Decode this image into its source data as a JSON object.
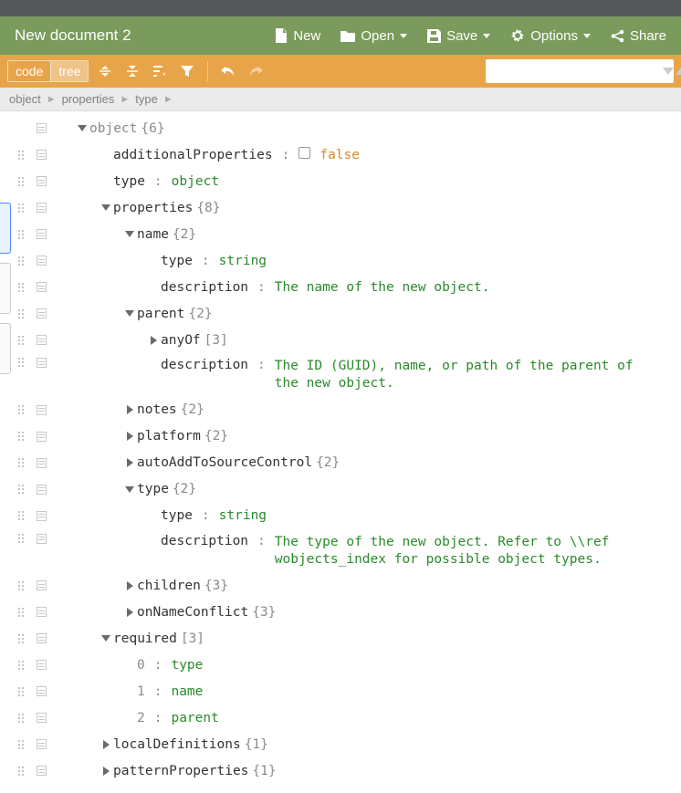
{
  "header": {
    "title": "New document 2",
    "menu": {
      "new": "New",
      "open": "Open",
      "save": "Save",
      "options": "Options",
      "share": "Share"
    }
  },
  "toolbar": {
    "mode_code": "code",
    "mode_tree": "tree",
    "search_placeholder": ""
  },
  "breadcrumb": {
    "parts": [
      "object",
      "properties",
      "type"
    ]
  },
  "tree": {
    "root": {
      "key": "object",
      "count": "{6}"
    },
    "addl": {
      "key": "additionalProperties",
      "value": "false"
    },
    "type_root": {
      "key": "type",
      "value": "object"
    },
    "props": {
      "key": "properties",
      "count": "{8}"
    },
    "name": {
      "key": "name",
      "count": "{2}"
    },
    "name_type": {
      "key": "type",
      "value": "string"
    },
    "name_desc": {
      "key": "description",
      "value": "The name of the new object."
    },
    "parent": {
      "key": "parent",
      "count": "{2}"
    },
    "parent_anyof": {
      "key": "anyOf",
      "count": "[3]"
    },
    "parent_desc": {
      "key": "description",
      "value": "The ID (GUID), name, or path of the parent of the new object."
    },
    "notes": {
      "key": "notes",
      "count": "{2}"
    },
    "platform": {
      "key": "platform",
      "count": "{2}"
    },
    "autoadd": {
      "key": "autoAddToSourceControl",
      "count": "{2}"
    },
    "type2": {
      "key": "type",
      "count": "{2}"
    },
    "type2_type": {
      "key": "type",
      "value": "string"
    },
    "type2_desc": {
      "key": "description",
      "value": "The type of the new object. Refer to \\\\ref wobjects_index for possible object types."
    },
    "children": {
      "key": "children",
      "count": "{3}"
    },
    "onname": {
      "key": "onNameConflict",
      "count": "{3}"
    },
    "required": {
      "key": "required",
      "count": "[3]"
    },
    "req0": {
      "key": "0",
      "value": "type"
    },
    "req1": {
      "key": "1",
      "value": "name"
    },
    "req2": {
      "key": "2",
      "value": "parent"
    },
    "localdef": {
      "key": "localDefinitions",
      "count": "{1}"
    },
    "pattern": {
      "key": "patternProperties",
      "count": "{1}"
    }
  }
}
